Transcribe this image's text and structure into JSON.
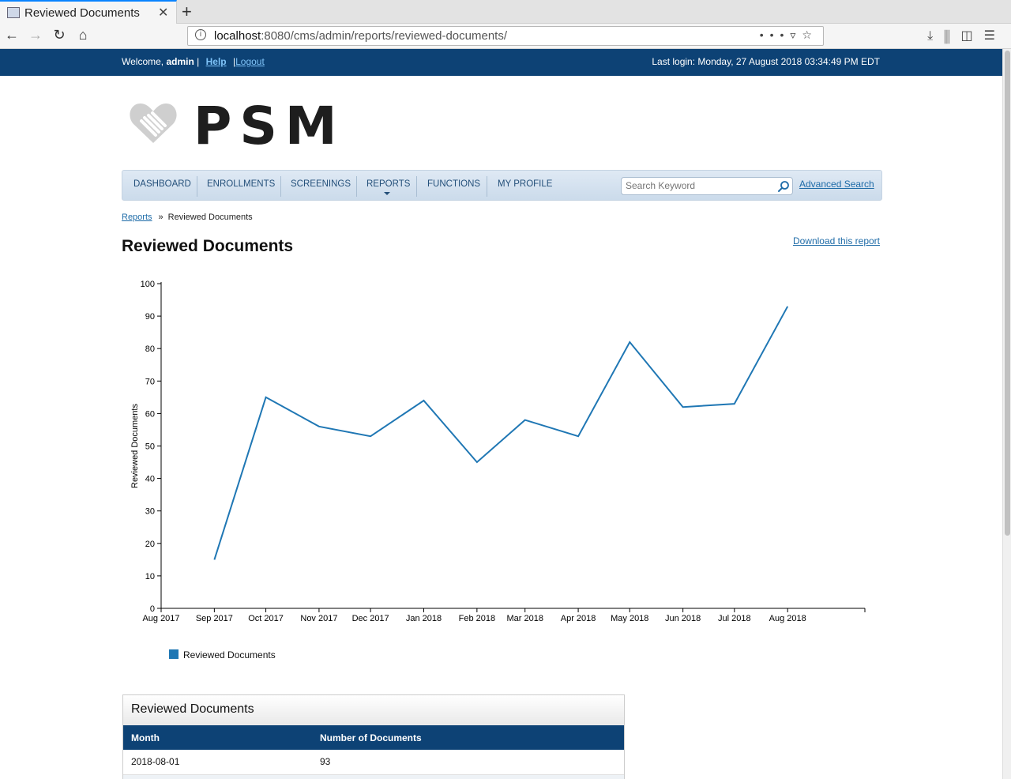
{
  "browser": {
    "tab_title": "Reviewed Documents",
    "url_host": "localhost",
    "url_rest": ":8080/cms/admin/reports/reviewed-documents/"
  },
  "topbar": {
    "welcome": "Welcome,",
    "user": "admin",
    "help": "Help",
    "logout": "Logout",
    "last_login": "Last login: Monday, 27 August 2018 03:34:49 PM EDT"
  },
  "logo": {
    "text": "PSM"
  },
  "nav": {
    "items": [
      "DASHBOARD",
      "ENROLLMENTS",
      "SCREENINGS",
      "REPORTS",
      "FUNCTIONS",
      "MY PROFILE"
    ],
    "search_placeholder": "Search Keyword",
    "advanced_search": "Advanced Search"
  },
  "breadcrumb": {
    "parent": "Reports",
    "sep": "»",
    "current": "Reviewed Documents"
  },
  "page": {
    "title": "Reviewed Documents",
    "download": "Download this report"
  },
  "chart_data": {
    "type": "line",
    "x_ticks": [
      "Aug 2017",
      "Sep 2017",
      "Oct 2017",
      "Nov 2017",
      "Dec 2017",
      "Jan 2018",
      "Feb 2018",
      "Mar 2018",
      "Apr 2018",
      "May 2018",
      "Jun 2018",
      "Jul 2018",
      "Aug 2018"
    ],
    "series": [
      {
        "name": "Reviewed Documents",
        "color": "#1f77b4",
        "points": [
          {
            "x": "2017-09-01",
            "y": 15
          },
          {
            "x": "2017-10-01",
            "y": 65
          },
          {
            "x": "2017-11-01",
            "y": 56
          },
          {
            "x": "2017-12-01",
            "y": 53
          },
          {
            "x": "2018-01-01",
            "y": 64
          },
          {
            "x": "2018-02-01",
            "y": 45
          },
          {
            "x": "2018-03-01",
            "y": 58
          },
          {
            "x": "2018-04-01",
            "y": 53
          },
          {
            "x": "2018-05-01",
            "y": 82
          },
          {
            "x": "2018-06-01",
            "y": 62
          },
          {
            "x": "2018-07-01",
            "y": 63
          },
          {
            "x": "2018-08-01",
            "y": 93
          }
        ]
      }
    ],
    "ylabel": "Reviewed Documents",
    "ylim": [
      0,
      100
    ],
    "y_ticks": [
      0,
      10,
      20,
      30,
      40,
      50,
      60,
      70,
      80,
      90,
      100
    ],
    "grid": false,
    "legend": "bottom-left"
  },
  "table": {
    "title": "Reviewed Documents",
    "columns": [
      "Month",
      "Number of Documents"
    ],
    "rows": [
      [
        "2018-08-01",
        "93"
      ],
      [
        "",
        ""
      ]
    ]
  }
}
